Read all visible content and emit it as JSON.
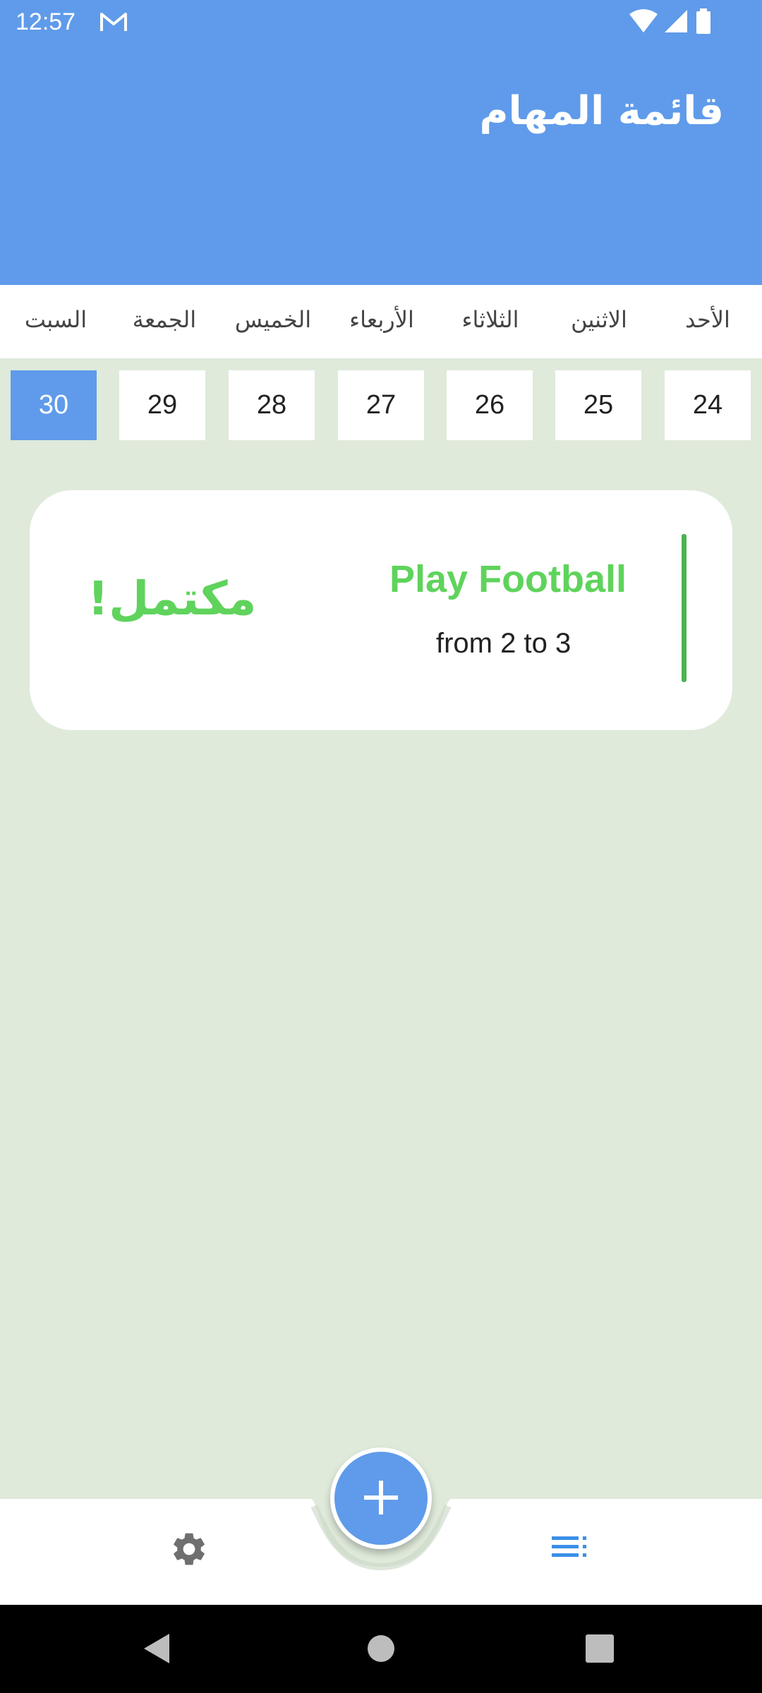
{
  "status_bar": {
    "time": "12:57",
    "icons": [
      "gmail-icon",
      "wifi-icon",
      "signal-icon",
      "battery-icon"
    ]
  },
  "header": {
    "title": "قائمة المهام"
  },
  "week": {
    "days": [
      "الأحد",
      "الاثنين",
      "الثلاثاء",
      "الأربعاء",
      "الخميس",
      "الجمعة",
      "السبت"
    ],
    "dates": [
      "24",
      "25",
      "26",
      "27",
      "28",
      "29",
      "30"
    ],
    "selected_date": "30"
  },
  "task": {
    "title": "Play Football",
    "time": "from 2 to 3",
    "status": "مكتمل!"
  },
  "bottom_nav": {
    "items": [
      "settings-icon",
      "list-icon"
    ],
    "fab_icon": "plus-icon"
  },
  "colors": {
    "primary": "#5f9bea",
    "background": "#dfeadb",
    "task_green": "#5fd35c",
    "accent_bar": "#4cb351"
  }
}
